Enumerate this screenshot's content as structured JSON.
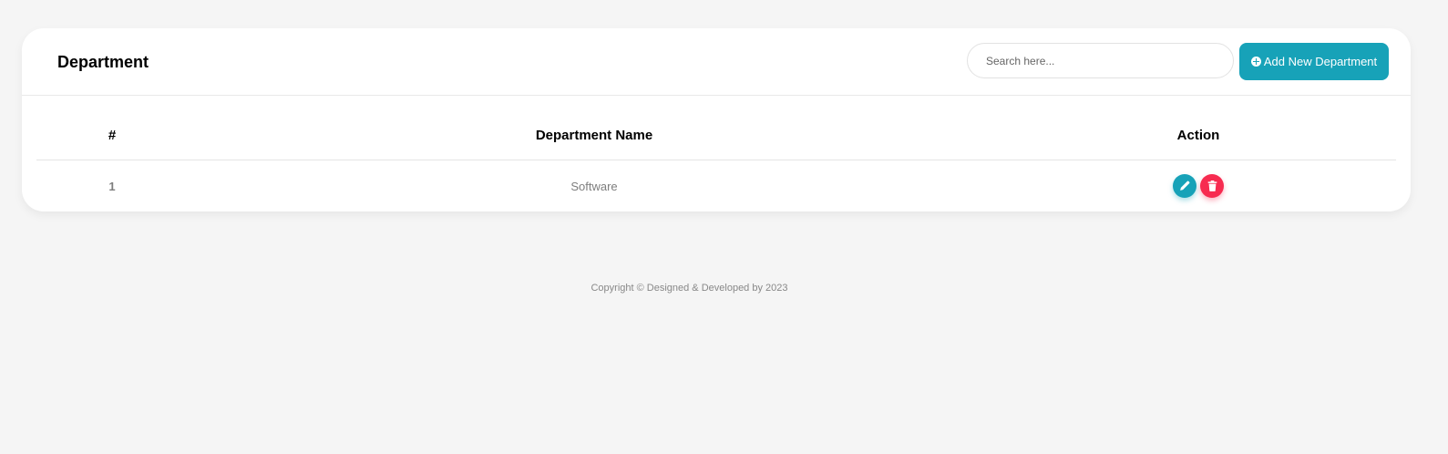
{
  "card": {
    "title": "Department"
  },
  "search": {
    "placeholder": "Search here..."
  },
  "add_button": {
    "label": "Add New Department",
    "icon": "plus-circle-icon"
  },
  "table": {
    "headers": [
      "#",
      "Department Name",
      "Action"
    ],
    "rows": [
      {
        "num": "1",
        "name": "Software"
      }
    ],
    "actions": {
      "edit_icon": "pencil-icon",
      "delete_icon": "trash-icon"
    }
  },
  "footer": {
    "text": "Copyright © Designed & Developed by 2023"
  },
  "colors": {
    "accent": "#17a2b8",
    "danger": "#f72b50",
    "background": "#f5f5f5",
    "card": "#ffffff"
  }
}
